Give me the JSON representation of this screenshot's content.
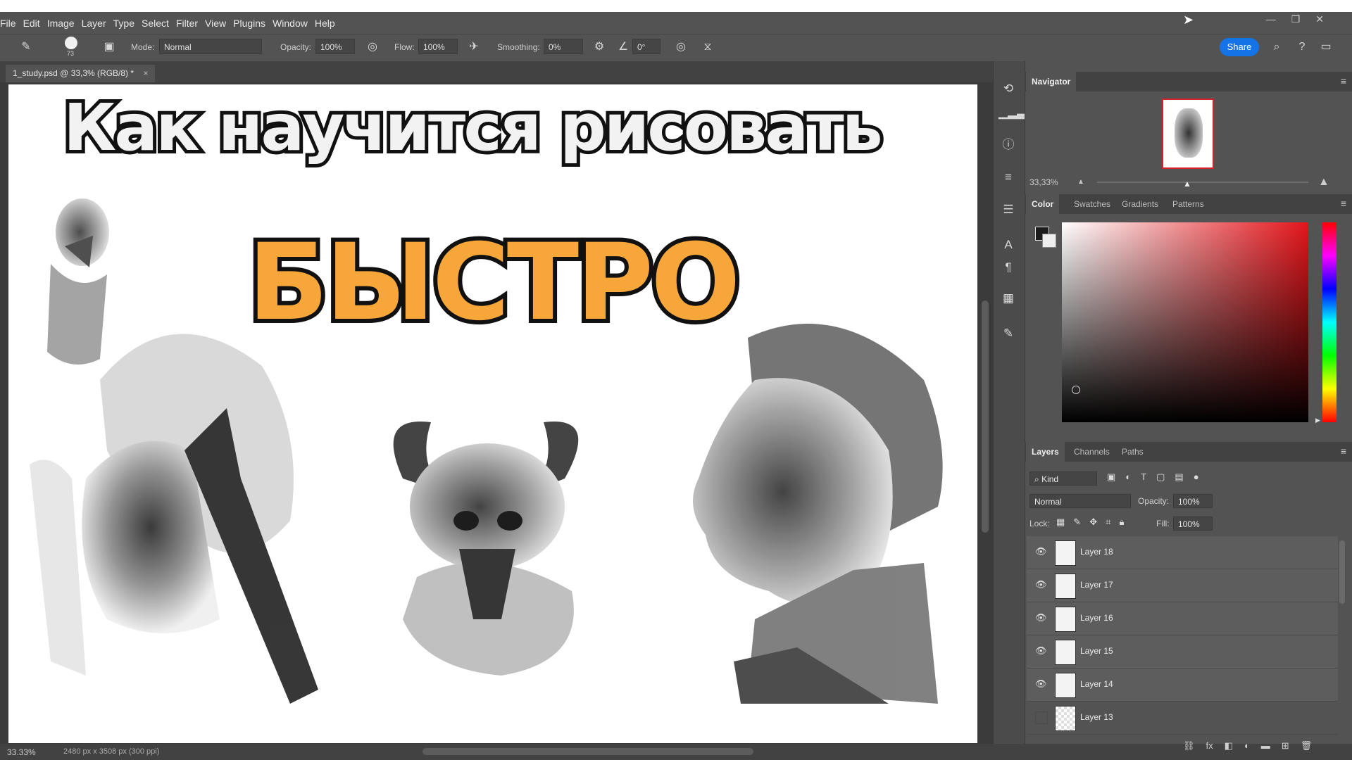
{
  "menu": [
    "File",
    "Edit",
    "Image",
    "Layer",
    "Type",
    "Select",
    "Filter",
    "View",
    "Plugins",
    "Window",
    "Help"
  ],
  "options": {
    "brush_size": "73",
    "mode_label": "Mode:",
    "mode_value": "Normal",
    "opacity_label": "Opacity:",
    "opacity_value": "100%",
    "flow_label": "Flow:",
    "flow_value": "100%",
    "smoothing_label": "Smoothing:",
    "smoothing_value": "0%",
    "angle_value": "0°",
    "share_label": "Share"
  },
  "document": {
    "tab_title": "1_study.psd @ 33,3% (RGB/8) *",
    "title_line1": "Как научится рисовать",
    "title_line2": "БЫСТРО"
  },
  "status": {
    "zoom": "33.33%",
    "doc_info": "2480 px x 3508 px (300 ppi)"
  },
  "navigator": {
    "tab": "Navigator",
    "zoom": "33,33%"
  },
  "color_panel": {
    "tabs": [
      "Color",
      "Swatches",
      "Gradients",
      "Patterns"
    ],
    "hue_color": "#e3151b"
  },
  "layers_panel": {
    "tabs": [
      "Layers",
      "Channels",
      "Paths"
    ],
    "filter_kind": "Kind",
    "blend_mode": "Normal",
    "opacity_label": "Opacity:",
    "opacity_value": "100%",
    "lock_label": "Lock:",
    "fill_label": "Fill:",
    "fill_value": "100%",
    "layers": [
      {
        "name": "Layer 18",
        "visible": true
      },
      {
        "name": "Layer 17",
        "visible": true
      },
      {
        "name": "Layer 16",
        "visible": true
      },
      {
        "name": "Layer 15",
        "visible": true
      },
      {
        "name": "Layer 14",
        "visible": true
      },
      {
        "name": "Layer 13",
        "visible": false
      }
    ]
  }
}
